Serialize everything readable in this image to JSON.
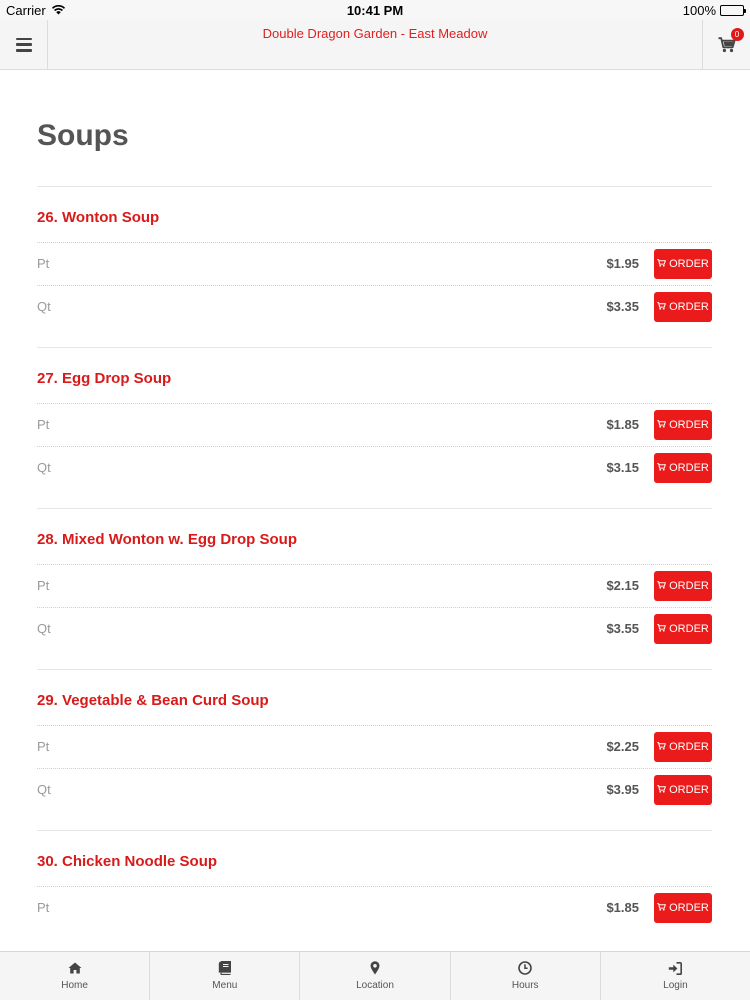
{
  "status_bar": {
    "carrier": "Carrier",
    "time": "10:41 PM",
    "battery": "100%"
  },
  "header": {
    "title": "Double Dragon Garden - East Meadow",
    "cart_count": "0"
  },
  "page": {
    "title": "Soups"
  },
  "order_label": "ORDER",
  "items": [
    {
      "name": "26. Wonton Soup",
      "options": [
        {
          "size": "Pt",
          "price": "$1.95"
        },
        {
          "size": "Qt",
          "price": "$3.35"
        }
      ]
    },
    {
      "name": "27. Egg Drop Soup",
      "options": [
        {
          "size": "Pt",
          "price": "$1.85"
        },
        {
          "size": "Qt",
          "price": "$3.15"
        }
      ]
    },
    {
      "name": "28. Mixed Wonton w. Egg Drop Soup",
      "options": [
        {
          "size": "Pt",
          "price": "$2.15"
        },
        {
          "size": "Qt",
          "price": "$3.55"
        }
      ]
    },
    {
      "name": "29. Vegetable & Bean Curd Soup",
      "options": [
        {
          "size": "Pt",
          "price": "$2.25"
        },
        {
          "size": "Qt",
          "price": "$3.95"
        }
      ]
    },
    {
      "name": "30. Chicken Noodle Soup",
      "options": [
        {
          "size": "Pt",
          "price": "$1.85"
        }
      ]
    }
  ],
  "tabbar": {
    "home": "Home",
    "menu": "Menu",
    "location": "Location",
    "hours": "Hours",
    "login": "Login"
  },
  "colors": {
    "accent": "#ec1b1b",
    "item_name": "#d91a1a"
  }
}
